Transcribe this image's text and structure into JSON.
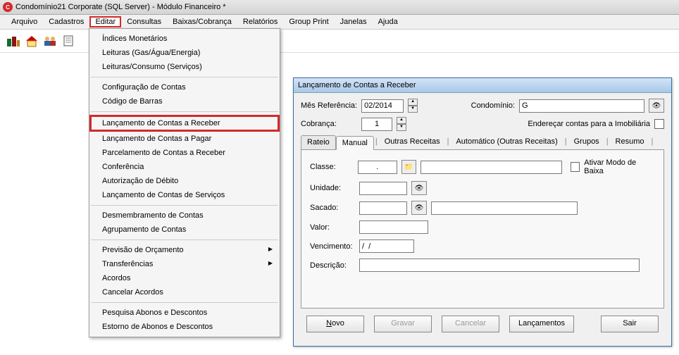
{
  "app": {
    "title": "Condomínio21 Corporate (SQL Server) - Módulo Financeiro *"
  },
  "menu": {
    "items": [
      "Arquivo",
      "Cadastros",
      "Editar",
      "Consultas",
      "Baixas/Cobrança",
      "Relatórios",
      "Group Print",
      "Janelas",
      "Ajuda"
    ],
    "active_index": 2
  },
  "dropdown": {
    "groups": [
      [
        "Índices Monetários",
        "Leituras (Gas/Água/Energia)",
        "Leituras/Consumo (Serviços)"
      ],
      [
        "Configuração de Contas",
        "Código de Barras"
      ],
      [
        "Lançamento de Contas a Receber",
        "Lançamento de Contas a Pagar",
        "Parcelamento de Contas a Receber",
        "Conferência",
        "Autorização de Débito",
        "Lançamento de Contas de Serviços"
      ],
      [
        "Desmembramento de Contas",
        "Agrupamento de Contas"
      ],
      [
        "Previsão de Orçamento",
        "Transferências",
        "Acordos",
        "Cancelar Acordos"
      ],
      [
        "Pesquisa  Abonos e Descontos",
        "Estorno de Abonos e Descontos"
      ]
    ],
    "arrows": [
      "Previsão de Orçamento",
      "Transferências"
    ],
    "highlight": "Lançamento de Contas a Receber"
  },
  "window": {
    "title": "Lançamento de Contas a Receber",
    "header": {
      "mes_label": "Mês Referência:",
      "mes_value": "02/2014",
      "cobranca_label": "Cobrança:",
      "cobranca_value": "1",
      "condominio_label": "Condomínio:",
      "condominio_value": "G",
      "enderecar_label": "Endereçar contas para a Imobiliária"
    },
    "tabs": [
      "Rateio",
      "Manual",
      "Outras Receitas",
      "Automático (Outras Receitas)",
      "Grupos",
      "Resumo"
    ],
    "active_tab": 1,
    "form": {
      "classe_label": "Classe:",
      "classe_value": ".",
      "ativar_label": "Ativar Modo de Baixa",
      "unidade_label": "Unidade:",
      "unidade_value": "",
      "sacado_label": "Sacado:",
      "sacado_value": "",
      "sacado_extra": "",
      "valor_label": "Valor:",
      "valor_value": "",
      "vencimento_label": "Vencimento:",
      "vencimento_value": "/  /",
      "descricao_label": "Descrição:",
      "descricao_value": ""
    },
    "buttons": {
      "novo": "Novo",
      "gravar": "Gravar",
      "cancelar": "Cancelar",
      "lancamentos": "Lançamentos",
      "sair": "Sair"
    }
  },
  "icons": {
    "binoculars": "🔍",
    "folder": "📁"
  }
}
